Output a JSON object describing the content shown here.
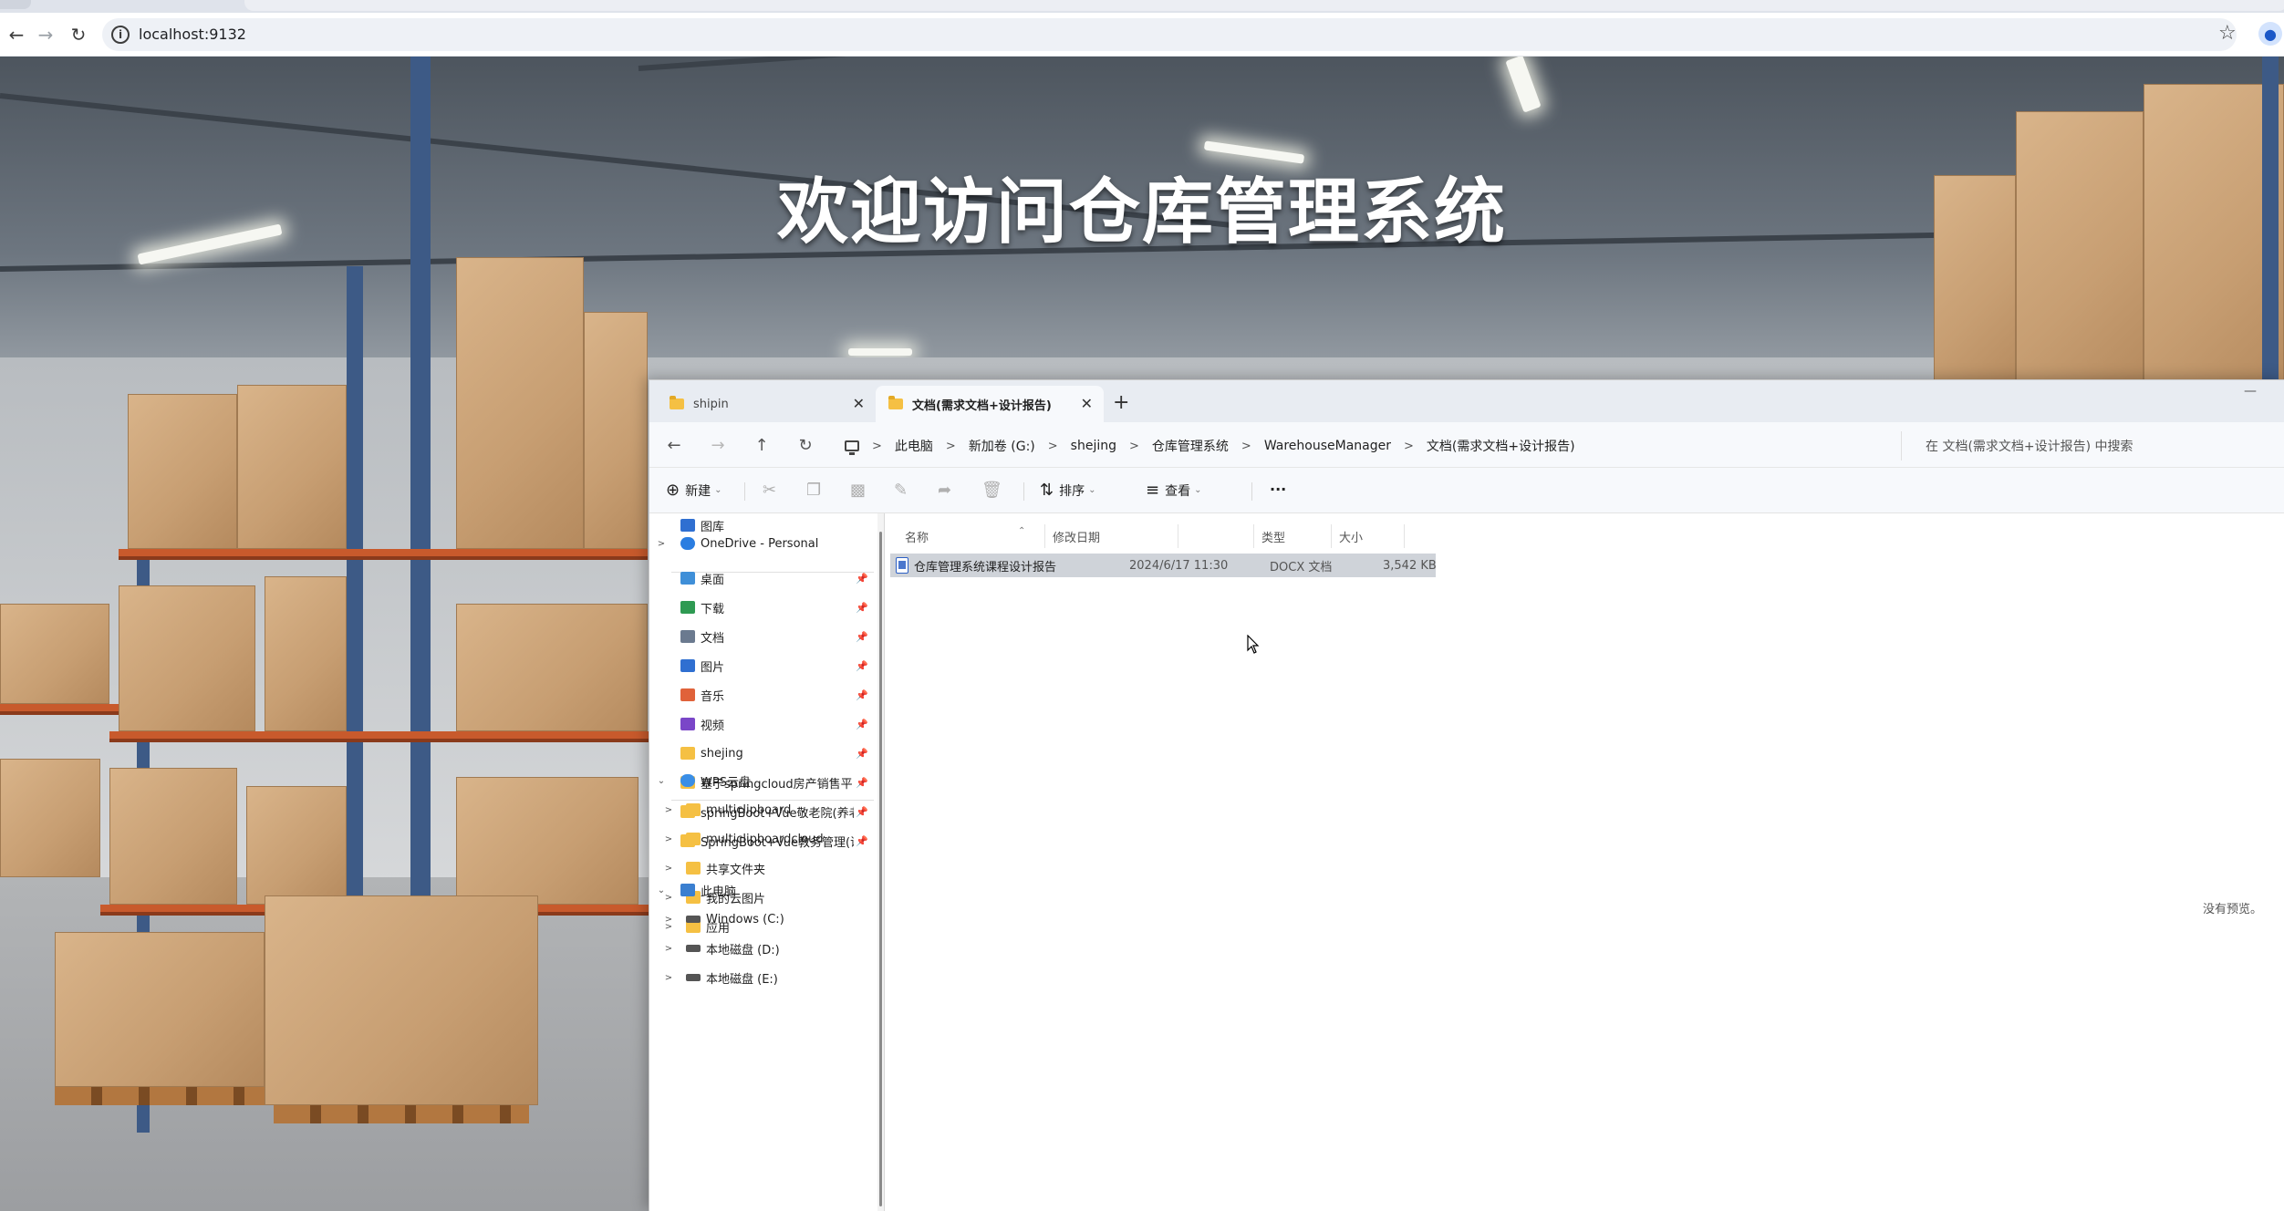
{
  "browser": {
    "url": "localhost:9132"
  },
  "page": {
    "welcome_title": "欢迎访问仓库管理系统"
  },
  "explorer": {
    "tabs": [
      {
        "label": "shipin",
        "active": false
      },
      {
        "label": "文档(需求文档+设计报告)",
        "active": true
      }
    ],
    "breadcrumb": [
      "此电脑",
      "新加卷 (G:)",
      "shejing",
      "仓库管理系统",
      "WarehouseManager",
      "文档(需求文档+设计报告)"
    ],
    "search_placeholder": "在 文档(需求文档+设计报告) 中搜索",
    "commands": {
      "new": "新建",
      "sort": "排序",
      "view": "查看",
      "more": "···"
    },
    "nav": {
      "gallery": "图库",
      "onedrive": "OneDrive - Personal",
      "quick": [
        {
          "label": "桌面",
          "icon": "desktop-icon",
          "color": "#3f8fd8"
        },
        {
          "label": "下载",
          "icon": "download-icon",
          "color": "#2e9a52"
        },
        {
          "label": "文档",
          "icon": "document-icon",
          "color": "#6b7a8f"
        },
        {
          "label": "图片",
          "icon": "pictures-icon",
          "color": "#2f6fd1"
        },
        {
          "label": "音乐",
          "icon": "music-icon",
          "color": "#e0623a"
        },
        {
          "label": "视频",
          "icon": "video-icon",
          "color": "#7a46c8"
        },
        {
          "label": "shejing",
          "icon": "folder-icon",
          "color": "#f5c043"
        },
        {
          "label": "基于springcloud房产销售平台源",
          "icon": "folder-icon",
          "color": "#f5c043"
        },
        {
          "label": "springBoot+Vue敬老院(养老院",
          "icon": "folder-icon",
          "color": "#f5c043"
        },
        {
          "label": "SpringBoot+Vue教务管理(课程",
          "icon": "folder-icon",
          "color": "#f5c043"
        }
      ],
      "wps": "WPS云盘",
      "wps_items": [
        "multiclipboard",
        "multiclipboardcloud",
        "共享文件夹",
        "我的云图片",
        "应用"
      ],
      "this_pc": "此电脑",
      "pc_items": [
        "Windows (C:)",
        "本地磁盘 (D:)",
        "本地磁盘 (E:)"
      ]
    },
    "columns": {
      "name": "名称",
      "date": "修改日期",
      "type": "类型",
      "size": "大小"
    },
    "files": [
      {
        "name": "仓库管理系统课程设计报告",
        "date": "2024/6/17 11:30",
        "type": "DOCX 文档",
        "size": "3,542 KB"
      }
    ],
    "preview_text": "没有预览。"
  }
}
